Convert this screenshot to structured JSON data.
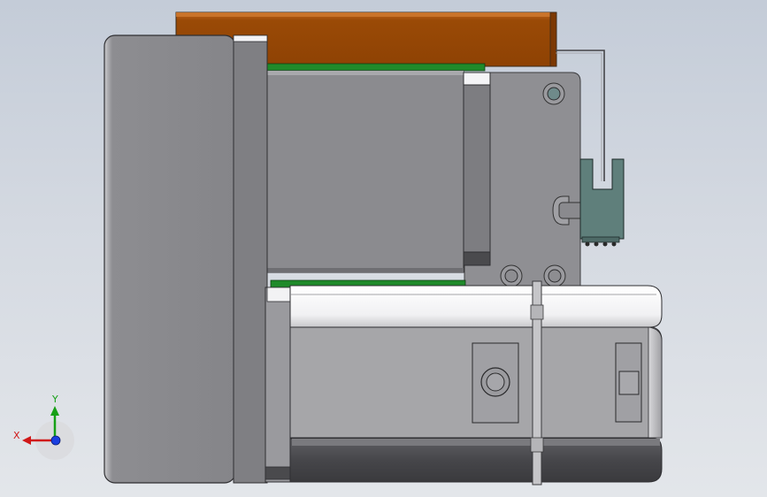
{
  "triad": {
    "x_label": "X",
    "y_label": "Y"
  },
  "colors": {
    "background_top": "#c4ccd8",
    "background_bottom": "#e3e6ea",
    "orange_board": "#9a4a06",
    "pcb_green": "#1f8a2a",
    "connector": "#5f7f7b",
    "axis_x": "#d01818",
    "axis_y": "#16a016",
    "axis_z": "#1a3fe0"
  }
}
